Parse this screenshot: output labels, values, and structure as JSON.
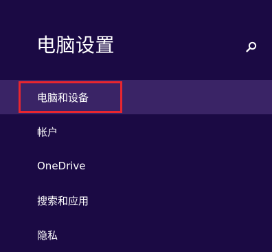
{
  "header": {
    "title": "电脑设置",
    "search_icon": "search-icon"
  },
  "nav": {
    "items": [
      {
        "label": "电脑和设备",
        "selected": true
      },
      {
        "label": "帐户",
        "selected": false
      },
      {
        "label": "OneDrive",
        "selected": false
      },
      {
        "label": "搜索和应用",
        "selected": false
      },
      {
        "label": "隐私",
        "selected": false
      }
    ]
  },
  "colors": {
    "background": "#1b0a44",
    "selected_item": "#3a2466",
    "highlight_border": "#e9262f",
    "text": "#ffffff"
  }
}
